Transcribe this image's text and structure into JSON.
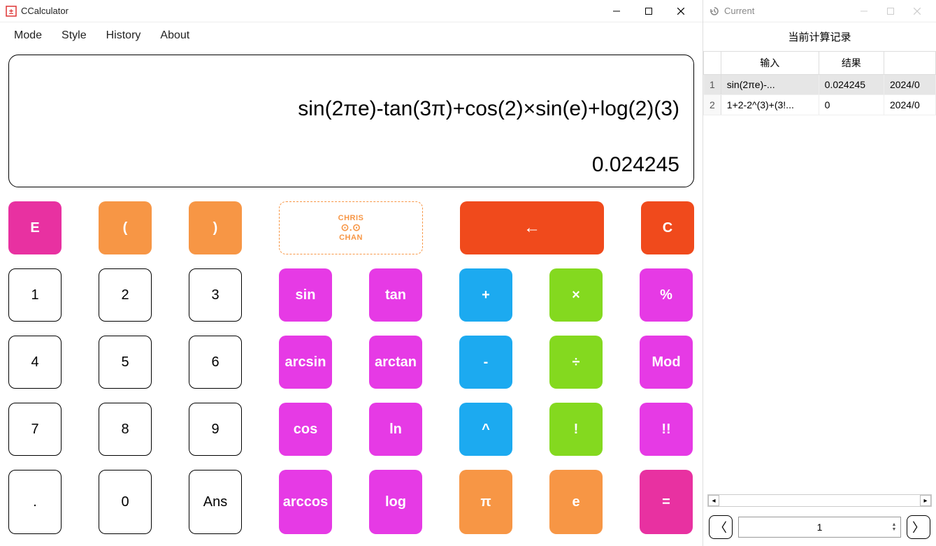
{
  "main": {
    "title": "CCalculator",
    "menu": [
      "Mode",
      "Style",
      "History",
      "About"
    ],
    "display": {
      "expression": "sin(2πe)-tan(3π)+cos(2)×sin(e)+log(2)(3)",
      "result": "0.024245"
    },
    "buttons": {
      "e_const": "E",
      "lparen": "(",
      "rparen": ")",
      "logo_top": "CHRIS",
      "logo_bottom": "CHAN",
      "backspace": "←",
      "clear": "C",
      "d1": "1",
      "d2": "2",
      "d3": "3",
      "d4": "4",
      "d5": "5",
      "d6": "6",
      "d7": "7",
      "d8": "8",
      "d9": "9",
      "d0": "0",
      "dot": ".",
      "ans": "Ans",
      "sin": "sin",
      "tan": "tan",
      "cos": "cos",
      "ln": "ln",
      "log": "log",
      "arcsin": "arcsin",
      "arctan": "arctan",
      "arccos": "arccos",
      "plus": "+",
      "minus": "-",
      "mult": "×",
      "div": "÷",
      "pow": "^",
      "fact": "!",
      "dfact": "!!",
      "percent": "%",
      "mod": "Mod",
      "pi": "π",
      "e_nat": "e",
      "equals": "="
    }
  },
  "history": {
    "title": "Current",
    "caption": "当前计算记录",
    "columns": {
      "input": "输入",
      "result": "结果",
      "time_partial": "2024/0"
    },
    "rows": [
      {
        "idx": "1",
        "input": "sin(2πe)-...",
        "result": "0.024245",
        "time": "2024/0",
        "selected": true
      },
      {
        "idx": "2",
        "input": "1+2-2^(3)+(3!...",
        "result": "0",
        "time": "2024/0",
        "selected": false
      }
    ],
    "pager": {
      "page": "1"
    }
  }
}
